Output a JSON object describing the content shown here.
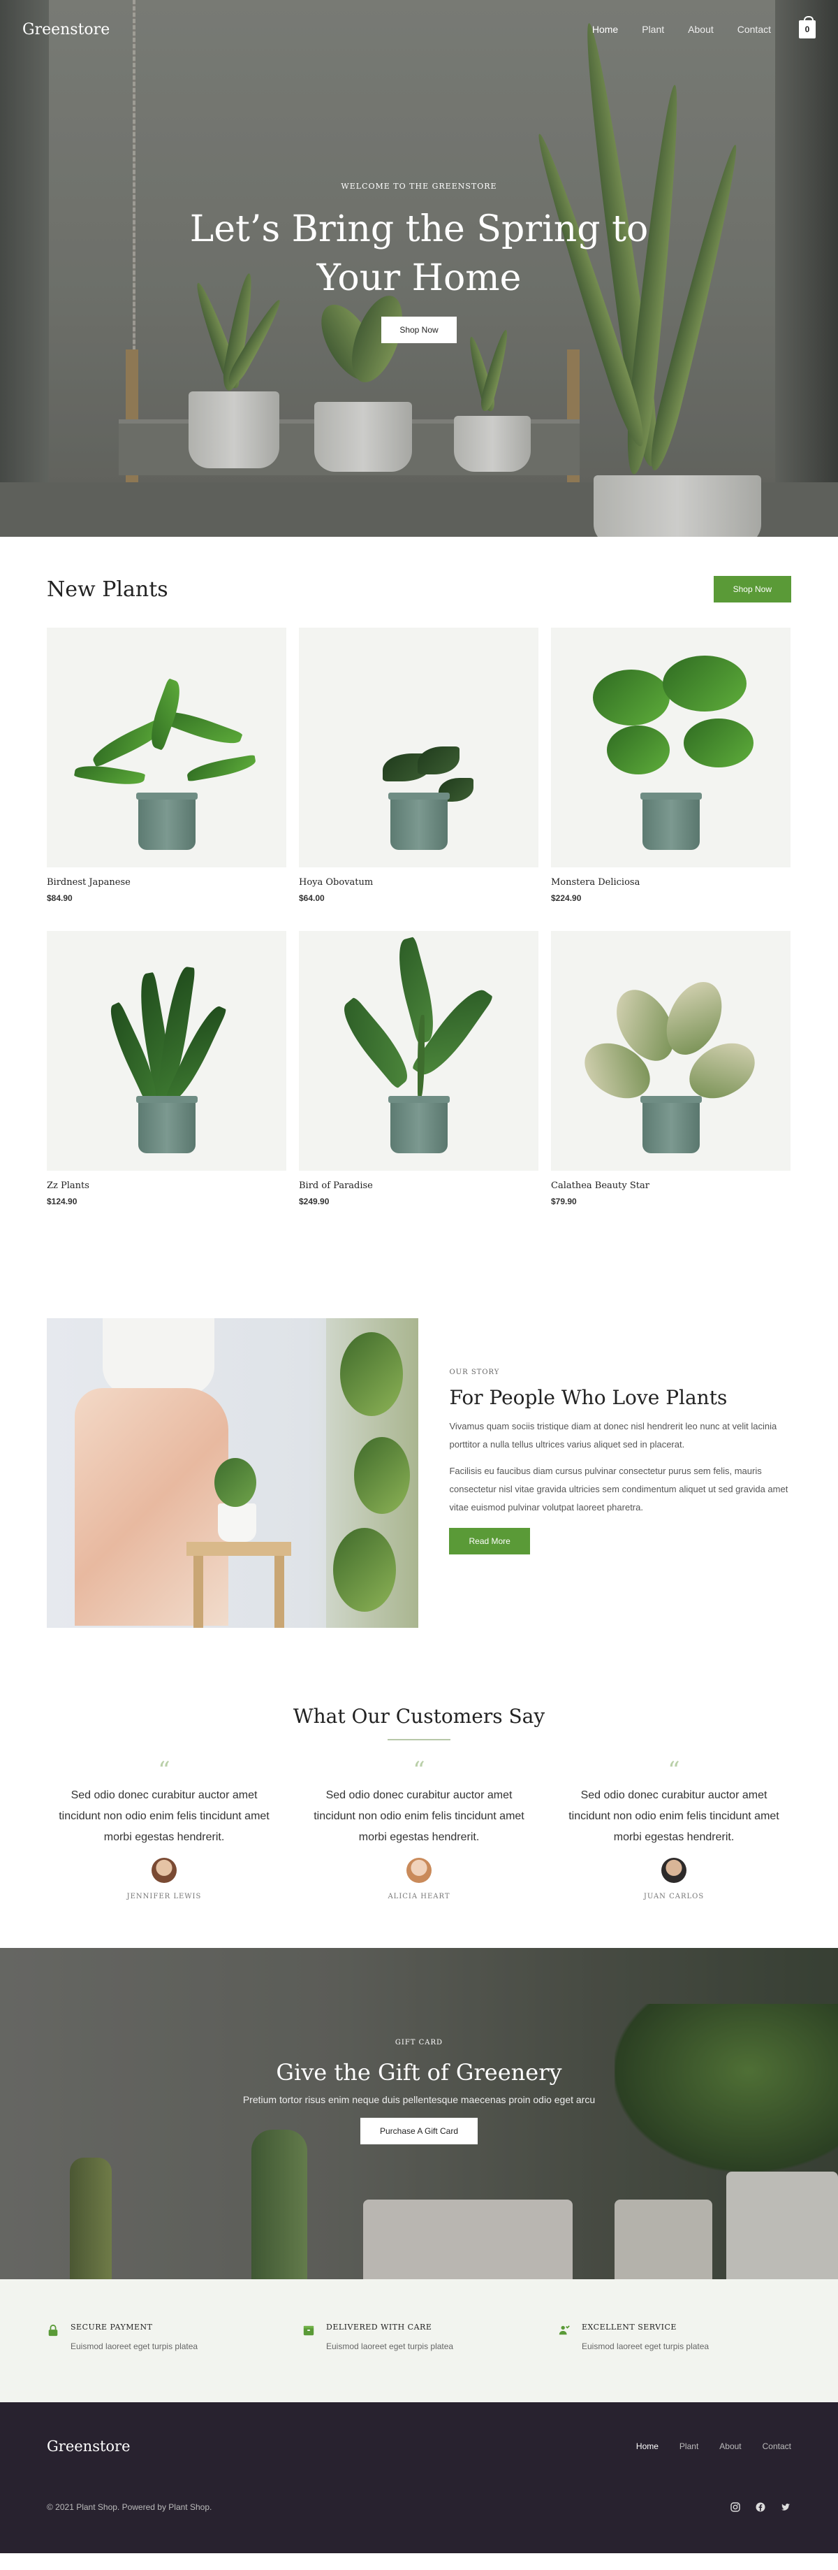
{
  "nav": {
    "brand": "Greenstore",
    "links": [
      "Home",
      "Plant",
      "About",
      "Contact"
    ],
    "cart_count": "0"
  },
  "hero": {
    "eyebrow": "WELCOME TO THE GREENSTORE",
    "title_line1": "Let’s Bring the Spring to",
    "title_line2": "Your Home",
    "button": "Shop Now"
  },
  "new_plants": {
    "title": "New Plants",
    "button": "Shop Now",
    "products": [
      {
        "name": "Birdnest Japanese",
        "price": "$84.90"
      },
      {
        "name": "Hoya Obovatum",
        "price": "$64.00"
      },
      {
        "name": "Monstera Deliciosa",
        "price": "$224.90"
      },
      {
        "name": "Zz Plants",
        "price": "$124.90"
      },
      {
        "name": "Bird of Paradise",
        "price": "$249.90"
      },
      {
        "name": "Calathea Beauty Star",
        "price": "$79.90"
      }
    ]
  },
  "story": {
    "eyebrow": "OUR STORY",
    "title": "For People Who Love Plants",
    "p1": "Vivamus quam sociis tristique diam at donec nisl hendrerit leo nunc at velit lacinia porttitor a nulla tellus ultrices varius aliquet sed in placerat.",
    "p2": "Facilisis eu faucibus diam cursus pulvinar consectetur purus sem felis, mauris consectetur nisl vitae gravida ultricies sem condimentum aliquet ut sed gravida amet vitae euismod pulvinar volutpat laoreet pharetra.",
    "button": "Read More"
  },
  "testimonials": {
    "title": "What Our Customers Say",
    "items": [
      {
        "quote": "Sed odio donec curabitur auctor amet tincidunt non odio enim felis tincidunt amet morbi egestas hendrerit.",
        "name": "JENNIFER LEWIS"
      },
      {
        "quote": "Sed odio donec curabitur auctor amet tincidunt non odio enim felis tincidunt amet morbi egestas hendrerit.",
        "name": "ALICIA HEART"
      },
      {
        "quote": "Sed odio donec curabitur auctor amet tincidunt non odio enim felis tincidunt amet morbi egestas hendrerit.",
        "name": "JUAN CARLOS"
      }
    ]
  },
  "gift": {
    "eyebrow": "GIFT CARD",
    "title": "Give the Gift of Greenery",
    "subtitle": "Pretium tortor risus enim neque duis pellentesque maecenas proin odio eget arcu",
    "button": "Purchase A Gift Card"
  },
  "features": [
    {
      "title": "SECURE PAYMENT",
      "text": "Euismod laoreet eget turpis platea",
      "icon": "lock-icon"
    },
    {
      "title": "DELIVERED WITH CARE",
      "text": "Euismod laoreet eget turpis platea",
      "icon": "package-icon"
    },
    {
      "title": "EXCELLENT SERVICE",
      "text": "Euismod laoreet eget turpis platea",
      "icon": "support-icon"
    }
  ],
  "footer": {
    "brand": "Greenstore",
    "links": [
      "Home",
      "Plant",
      "About",
      "Contact"
    ],
    "copyright": "© 2021 Plant Shop. Powered by Plant Shop.",
    "socials": [
      "instagram-icon",
      "facebook-icon",
      "twitter-icon"
    ]
  },
  "colors": {
    "accent_green": "#5a9a37",
    "footer_bg": "#28222f",
    "features_bg": "#f2f4ef",
    "card_bg": "#f3f4f1"
  }
}
